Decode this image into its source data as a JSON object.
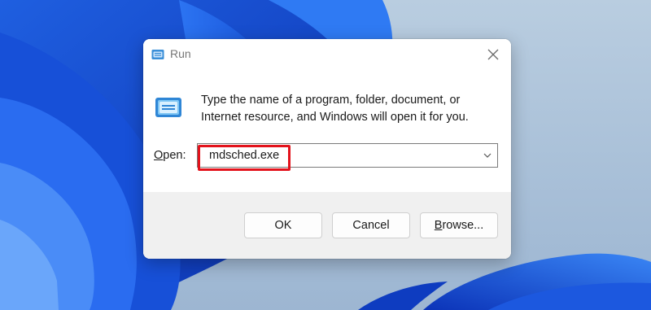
{
  "dialog": {
    "title": "Run",
    "description_line1": "Type the name of a program, folder, document, or",
    "description_line2": "Internet resource, and Windows will open it for you.",
    "open_label_prefix": "",
    "open_label_accel": "O",
    "open_label_rest": "pen:",
    "open_value": "mdsched.exe",
    "buttons": {
      "ok": "OK",
      "cancel": "Cancel",
      "browse_prefix": "",
      "browse_accel": "B",
      "browse_rest": "rowse..."
    }
  },
  "icons": {
    "title": "run-app-icon",
    "body": "run-app-icon",
    "close": "close-icon",
    "dropdown": "chevron-down-icon"
  },
  "colors": {
    "highlight": "#e3121b",
    "footer_background": "#f0f0f0",
    "title_text": "#777777"
  }
}
